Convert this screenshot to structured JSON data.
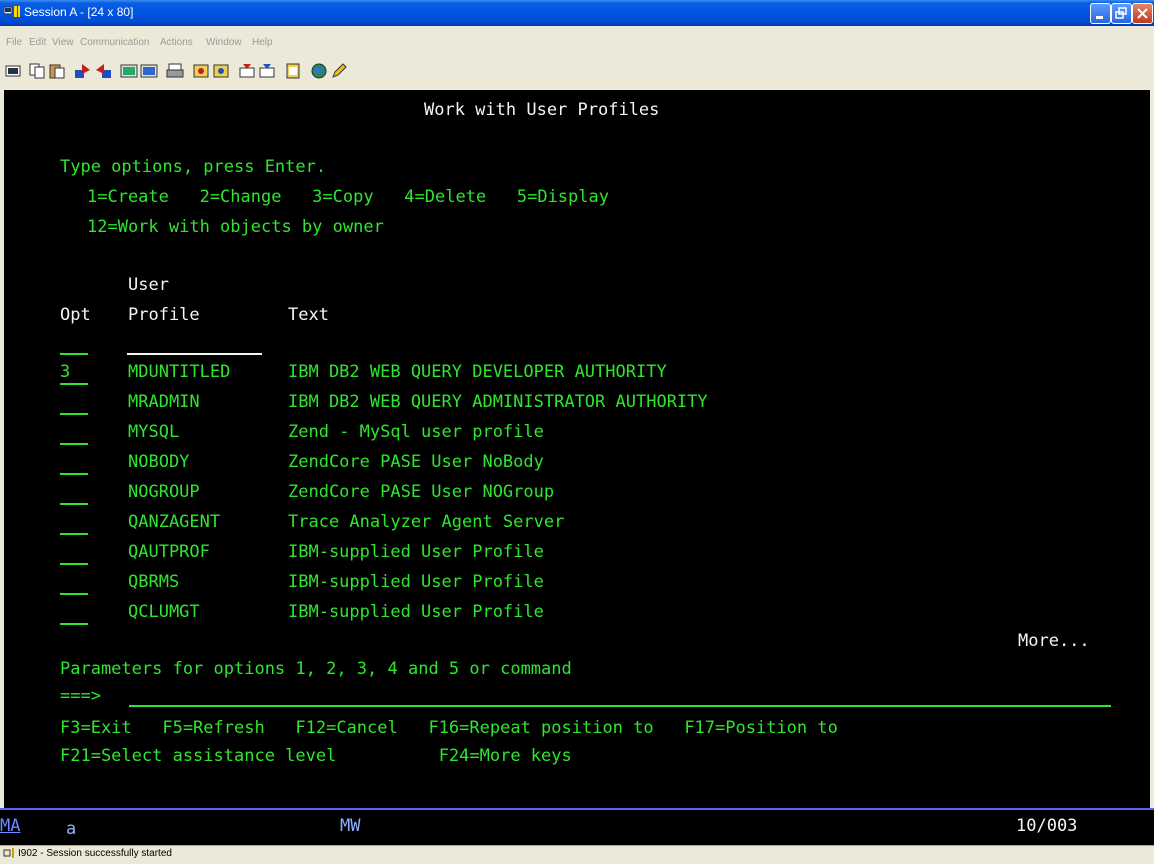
{
  "window": {
    "title": "Session A - [24 x 80]"
  },
  "menu": [
    "File",
    "Edit",
    "View",
    "Communication",
    "Actions",
    "Window",
    "Help"
  ],
  "screen": {
    "title": "Work with User Profiles",
    "instructions": "Type options, press Enter.",
    "options_line1": "1=Create   2=Change   3=Copy   4=Delete   5=Display",
    "options_line2": "12=Work with objects by owner",
    "col_user": "User",
    "col_opt": "Opt",
    "col_profile": "Profile",
    "col_text": "Text",
    "rows": [
      {
        "opt": "3",
        "profile": "MDUNTITLED",
        "text": "IBM DB2 WEB QUERY DEVELOPER AUTHORITY"
      },
      {
        "opt": "",
        "profile": "MRADMIN",
        "text": "IBM DB2 WEB QUERY ADMINISTRATOR AUTHORITY"
      },
      {
        "opt": "",
        "profile": "MYSQL",
        "text": "Zend - MySql user profile"
      },
      {
        "opt": "",
        "profile": "NOBODY",
        "text": "ZendCore PASE User NoBody"
      },
      {
        "opt": "",
        "profile": "NOGROUP",
        "text": "ZendCore PASE User NOGroup"
      },
      {
        "opt": "",
        "profile": "QANZAGENT",
        "text": "Trace Analyzer Agent Server"
      },
      {
        "opt": "",
        "profile": "QAUTPROF",
        "text": "IBM-supplied User Profile"
      },
      {
        "opt": "",
        "profile": "QBRMS",
        "text": "IBM-supplied User Profile"
      },
      {
        "opt": "",
        "profile": "QCLUMGT",
        "text": "IBM-supplied User Profile"
      }
    ],
    "more": "More...",
    "params_label": "Parameters for options 1, 2, 3, 4 and 5 or command",
    "cmd_prompt": "===>",
    "fkeys1": "F3=Exit   F5=Refresh   F12=Cancel   F16=Repeat position to   F17=Position to",
    "fkeys2": "F21=Select assistance level          F24=More keys"
  },
  "oia": {
    "ma": "MA",
    "a": "a",
    "mw": "MW",
    "cursor": "10/003"
  },
  "status": {
    "text": "I902 - Session successfully started"
  },
  "colors": {
    "terminal_bg": "#000000",
    "green": "#2ee62e",
    "white": "#f5f5f5"
  }
}
